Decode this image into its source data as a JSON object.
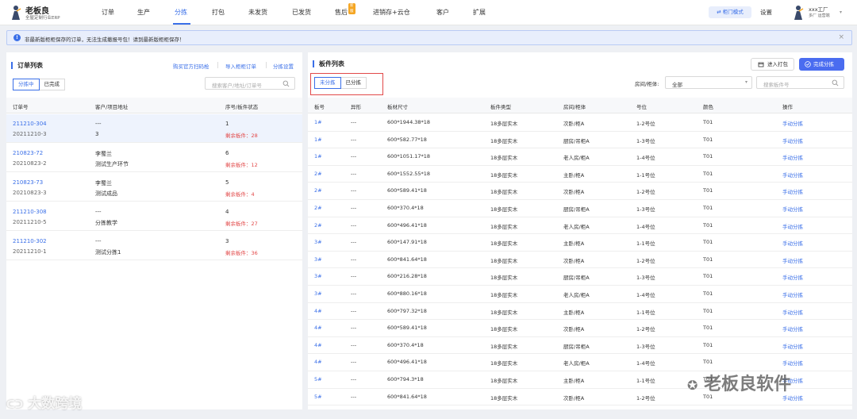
{
  "brand": {
    "title": "老板良",
    "subtitle": "全屋定制行业ERP"
  },
  "nav": [
    {
      "label": "订单",
      "active": false,
      "badge": null
    },
    {
      "label": "生产",
      "active": false,
      "badge": null
    },
    {
      "label": "分拣",
      "active": true,
      "badge": null
    },
    {
      "label": "打包",
      "active": false,
      "badge": null
    },
    {
      "label": "未发货",
      "active": false,
      "badge": null
    },
    {
      "label": "已发货",
      "active": false,
      "badge": null
    },
    {
      "label": "售后",
      "active": false,
      "badge": "新版"
    },
    {
      "label": "进销存+云仓",
      "active": false,
      "badge": null
    },
    {
      "label": "客户",
      "active": false,
      "badge": null
    },
    {
      "label": "扩展",
      "active": false,
      "badge": null
    }
  ],
  "header_right": {
    "mode_button": "⇄ 柜门模式",
    "settings": "设置",
    "user_name": "xxx工厂",
    "user_role": "多厂 运营端"
  },
  "notice": {
    "text": "非最新版柜柜保存的订单，无法生成撤报号包！请到最新版柜柜保存！"
  },
  "order_list": {
    "title": "订单列表",
    "links": [
      "购买官方扫码枪",
      "导入柜柜订单",
      "分拣设置"
    ],
    "tabs": [
      "分拣中",
      "已完成"
    ],
    "search_placeholder": "搜索客户/地址/订单号",
    "columns": [
      "订单号",
      "客户/项目地址",
      "序号/板件状态"
    ],
    "rows": [
      {
        "order_no": "211210-304",
        "sub_no": "20211210-3",
        "customer": "---",
        "address": "3",
        "seq": "1",
        "remain": "剩余板件：28"
      },
      {
        "order_no": "210823-72",
        "sub_no": "20210823-2",
        "customer": "李蜀兰",
        "address": "测试生产环节",
        "seq": "6",
        "remain": "剩余板件：12"
      },
      {
        "order_no": "210823-73",
        "sub_no": "20210823-3",
        "customer": "李蜀兰",
        "address": "测试成品",
        "seq": "5",
        "remain": "剩余板件：4"
      },
      {
        "order_no": "211210-308",
        "sub_no": "20211210-5",
        "customer": "---",
        "address": "分拣教学",
        "seq": "4",
        "remain": "剩余板件：27"
      },
      {
        "order_no": "211210-302",
        "sub_no": "20211210-1",
        "customer": "---",
        "address": "测试分拣1",
        "seq": "3",
        "remain": "剩余板件：36"
      }
    ]
  },
  "panel_list": {
    "title": "板件列表",
    "enter_pack": "进入打包",
    "complete_sort": "完成分拣",
    "tabs": [
      "未分拣",
      "已分拣"
    ],
    "room_label": "房间/柜体:",
    "room_value": "全部",
    "search_placeholder": "搜索板件号",
    "columns": [
      "板号",
      "异形",
      "板材尺寸",
      "板件类型",
      "房间/柜体",
      "号位",
      "颜色",
      "操作"
    ],
    "rows": [
      {
        "no": "1#",
        "shape": "---",
        "size": "600*1944.38*18",
        "type": "18多层实木",
        "room": "次卧/柜A",
        "pos": "1-2号位",
        "color": "T01",
        "action": "手动分拣"
      },
      {
        "no": "1#",
        "shape": "---",
        "size": "600*582.77*18",
        "type": "18多层实木",
        "room": "厨房/吊柜A",
        "pos": "1-3号位",
        "color": "T01",
        "action": "手动分拣"
      },
      {
        "no": "1#",
        "shape": "---",
        "size": "600*1051.17*18",
        "type": "18多层实木",
        "room": "老人房/柜A",
        "pos": "1-4号位",
        "color": "T01",
        "action": "手动分拣"
      },
      {
        "no": "2#",
        "shape": "---",
        "size": "600*1552.55*18",
        "type": "18多层实木",
        "room": "主卧/柜A",
        "pos": "1-1号位",
        "color": "T01",
        "action": "手动分拣"
      },
      {
        "no": "2#",
        "shape": "---",
        "size": "600*589.41*18",
        "type": "18多层实木",
        "room": "次卧/柜A",
        "pos": "1-2号位",
        "color": "T01",
        "action": "手动分拣"
      },
      {
        "no": "2#",
        "shape": "---",
        "size": "600*370.4*18",
        "type": "18多层实木",
        "room": "厨房/吊柜A",
        "pos": "1-3号位",
        "color": "T01",
        "action": "手动分拣"
      },
      {
        "no": "2#",
        "shape": "---",
        "size": "600*496.41*18",
        "type": "18多层实木",
        "room": "老人房/柜A",
        "pos": "1-4号位",
        "color": "T01",
        "action": "手动分拣"
      },
      {
        "no": "3#",
        "shape": "---",
        "size": "600*147.91*18",
        "type": "18多层实木",
        "room": "主卧/柜A",
        "pos": "1-1号位",
        "color": "T01",
        "action": "手动分拣"
      },
      {
        "no": "3#",
        "shape": "---",
        "size": "600*841.64*18",
        "type": "18多层实木",
        "room": "次卧/柜A",
        "pos": "1-2号位",
        "color": "T01",
        "action": "手动分拣"
      },
      {
        "no": "3#",
        "shape": "---",
        "size": "600*216.28*18",
        "type": "18多层实木",
        "room": "厨房/吊柜A",
        "pos": "1-3号位",
        "color": "T01",
        "action": "手动分拣"
      },
      {
        "no": "3#",
        "shape": "---",
        "size": "600*880.16*18",
        "type": "18多层实木",
        "room": "老人房/柜A",
        "pos": "1-4号位",
        "color": "T01",
        "action": "手动分拣"
      },
      {
        "no": "4#",
        "shape": "---",
        "size": "600*797.32*18",
        "type": "18多层实木",
        "room": "主卧/柜A",
        "pos": "1-1号位",
        "color": "T01",
        "action": "手动分拣"
      },
      {
        "no": "4#",
        "shape": "---",
        "size": "600*589.41*18",
        "type": "18多层实木",
        "room": "次卧/柜A",
        "pos": "1-2号位",
        "color": "T01",
        "action": "手动分拣"
      },
      {
        "no": "4#",
        "shape": "---",
        "size": "600*370.4*18",
        "type": "18多层实木",
        "room": "厨房/吊柜A",
        "pos": "1-3号位",
        "color": "T01",
        "action": "手动分拣"
      },
      {
        "no": "4#",
        "shape": "---",
        "size": "600*496.41*18",
        "type": "18多层实木",
        "room": "老人房/柜A",
        "pos": "1-4号位",
        "color": "T01",
        "action": "手动分拣"
      },
      {
        "no": "5#",
        "shape": "---",
        "size": "600*794.3*18",
        "type": "18多层实木",
        "room": "主卧/柜A",
        "pos": "1-1号位",
        "color": "T01",
        "action": "手动分拣"
      },
      {
        "no": "5#",
        "shape": "---",
        "size": "600*841.64*18",
        "type": "18多层实木",
        "room": "次卧/柜A",
        "pos": "1-2号位",
        "color": "T01",
        "action": "手动分拣"
      }
    ]
  },
  "watermarks": {
    "left": "大数跨境",
    "right": "老板良软件"
  },
  "colors": {
    "accent": "#3a6fe8",
    "danger": "#e24848",
    "primary_button": "#4a6cf0"
  }
}
